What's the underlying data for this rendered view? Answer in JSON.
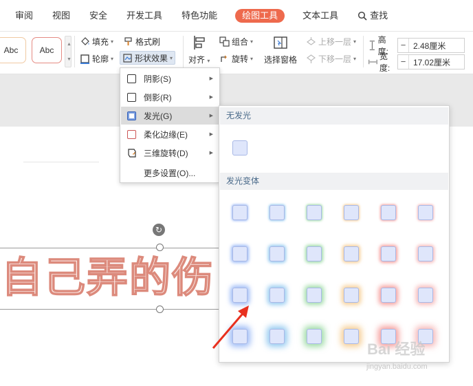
{
  "tabs": [
    {
      "label": "审阅",
      "active": false
    },
    {
      "label": "视图",
      "active": false
    },
    {
      "label": "安全",
      "active": false
    },
    {
      "label": "开发工具",
      "active": false
    },
    {
      "label": "特色功能",
      "active": false
    },
    {
      "label": "绘图工具",
      "active": true
    },
    {
      "label": "文本工具",
      "active": false
    }
  ],
  "search_label": "查找",
  "style_gallery": [
    "Abc",
    "Abc"
  ],
  "ribbon": {
    "fill": "填充",
    "outline": "轮廓",
    "format_painter": "格式刷",
    "shape_effect": "形状效果",
    "align": "对齐",
    "group": "组合",
    "rotate": "旋转",
    "selection_pane": "选择窗格",
    "bring_forward": "上移一层",
    "send_backward": "下移一层",
    "height_label": "高度:",
    "height_value": "2.48厘米",
    "width_label": "宽度:",
    "width_value": "17.02厘米"
  },
  "document_text": "自己弄的伤",
  "effect_menu": [
    {
      "label": "阴影(S)",
      "submenu": true
    },
    {
      "label": "倒影(R)",
      "submenu": true
    },
    {
      "label": "发光(G)",
      "submenu": true
    },
    {
      "label": "柔化边缘(E)",
      "submenu": true
    },
    {
      "label": "三维旋转(D)",
      "submenu": true
    },
    {
      "label": "更多设置(O)...",
      "submenu": false
    }
  ],
  "glow": {
    "no_glow_header": "无发光",
    "variants_header": "发光变体",
    "glow_colors": [
      "#5b8ef0",
      "#4fa6e6",
      "#5fc46d",
      "#f0ad4e",
      "#ee5f5b",
      "#f08c8c"
    ]
  },
  "watermark": "Bai 经验",
  "watermark_url": "jingyan.baidu.com"
}
